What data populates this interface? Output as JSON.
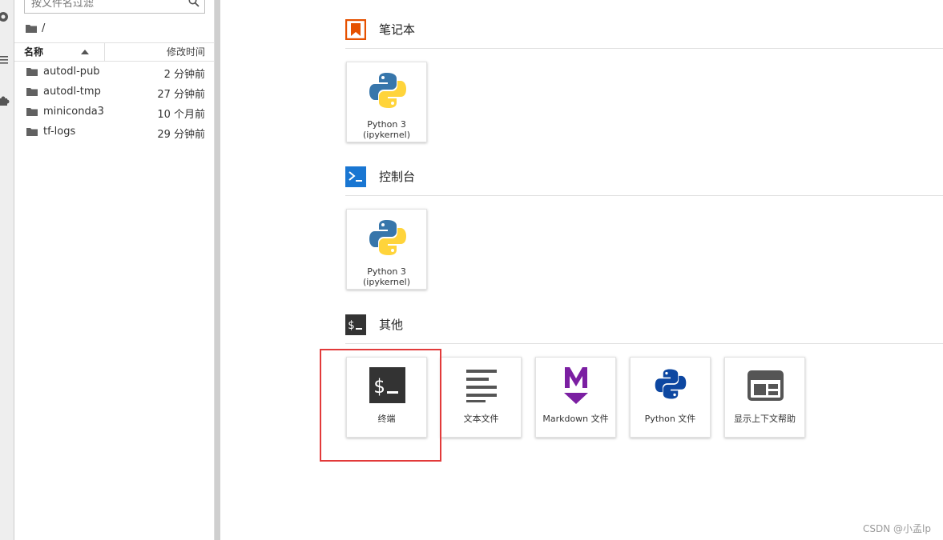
{
  "file_browser": {
    "filter_placeholder": "按文件名过滤",
    "breadcrumb": "/",
    "columns": {
      "name": "名称",
      "modified": "修改时间"
    },
    "files": [
      {
        "name": "autodl-pub",
        "modified": "2 分钟前"
      },
      {
        "name": "autodl-tmp",
        "modified": "27 分钟前"
      },
      {
        "name": "miniconda3",
        "modified": "10 个月前"
      },
      {
        "name": "tf-logs",
        "modified": "29 分钟前"
      }
    ]
  },
  "launcher": {
    "sections": [
      {
        "title": "笔记本",
        "icon": "notebook-icon",
        "color": "#e65100",
        "cards": [
          {
            "label1": "Python 3",
            "label2": "(ipykernel)",
            "icon": "python-icon"
          }
        ]
      },
      {
        "title": "控制台",
        "icon": "console-icon",
        "color": "#1976d2",
        "cards": [
          {
            "label1": "Python 3",
            "label2": "(ipykernel)",
            "icon": "python-icon"
          }
        ]
      },
      {
        "title": "其他",
        "icon": "terminal-icon",
        "color": "#333333",
        "cards": [
          {
            "label": "终端",
            "icon": "terminal-icon"
          },
          {
            "label": "文本文件",
            "icon": "text-file-icon"
          },
          {
            "label": "Markdown 文件",
            "icon": "markdown-icon"
          },
          {
            "label": "Python 文件",
            "icon": "python-file-icon"
          },
          {
            "label": "显示上下文帮助",
            "icon": "context-help-icon"
          }
        ]
      }
    ]
  },
  "watermark": "CSDN @小孟lp"
}
